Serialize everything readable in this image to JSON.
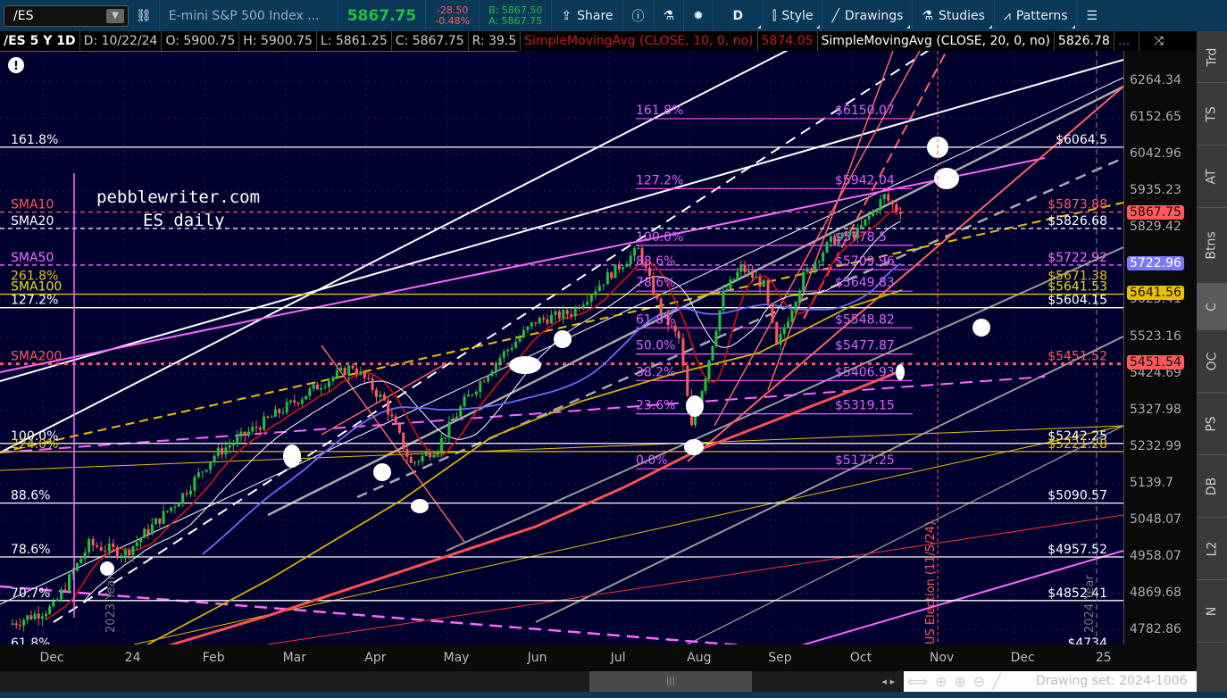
{
  "toolbar": {
    "symbol": "/ES",
    "description": "E-mini S&P 500 Index ...",
    "last": "5867.75",
    "change": "-28.50",
    "change_pct": "-0.48%",
    "bid": "B: 5867.50",
    "ask": "A: 5867.75",
    "share": "Share",
    "aggregation": "D",
    "style": "Style",
    "drawings": "Drawings",
    "studies": "Studies",
    "patterns": "Patterns",
    "colors": {
      "up": "#1ec23a",
      "down": "#ff5a5a",
      "bg": "#0b3857"
    }
  },
  "header": {
    "title": "/ES 5 Y 1D",
    "date": "D: 10/22/24",
    "open": "O: 5900.75",
    "high": "H: 5900.75",
    "low": "L: 5861.25",
    "close": "C: 5867.75",
    "range": "R: 39.5",
    "sma10_label": "SimpleMovingAvg (CLOSE, 10, 0, no)",
    "sma10_value": "5874.05",
    "sma20_label": "SimpleMovingAvg (CLOSE, 20, 0, no)",
    "sma20_value": "5826.78",
    "more": "..."
  },
  "watermark": {
    "line1": "pebblewriter.com",
    "line2": "ES daily"
  },
  "vertical_notes": {
    "election": "US Election (11/5/24)",
    "year2024": "2024 Year",
    "year2023": "2023 Year"
  },
  "price_axis": [
    "6264.34",
    "6152.65",
    "6042.96",
    "5935.23",
    "5829.42",
    "5625.41",
    "5523.16",
    "5424.69",
    "5327.98",
    "5232.99",
    "5139.7",
    "5048.07",
    "4958.07",
    "4869.68",
    "4782.86"
  ],
  "price_badges": [
    {
      "value": "5867.75",
      "color": "#ff5a5a"
    },
    {
      "value": "5722.96",
      "color": "#7a78ff"
    },
    {
      "value": "5641.56",
      "color": "#e8c000"
    },
    {
      "value": "5451.54",
      "color": "#ff5a5a"
    }
  ],
  "levels": [
    {
      "left": "161.8%",
      "right": "$6064.5",
      "price": 6064.5,
      "color": "#ffffff",
      "style": "solid"
    },
    {
      "left": "SMA10",
      "right": "$5873.88",
      "price": 5873.88,
      "color": "#ff5a5a",
      "style": "dash",
      "label_color": "#ff5a5a"
    },
    {
      "left": "SMA20",
      "right": "$5826.68",
      "price": 5826.68,
      "color": "#ffffff",
      "style": "dash"
    },
    {
      "left": "SMA50",
      "right": "$5722.92",
      "price": 5722.92,
      "color": "#ff66ff",
      "style": "dash",
      "label_color": "#ff66ff"
    },
    {
      "left": "261.8%",
      "right": "$5671.38",
      "price": 5671.38,
      "color": "#e8c000",
      "style": "none",
      "label_color": "#e8c000"
    },
    {
      "left": "SMA100",
      "right": "$5641.53",
      "price": 5641.53,
      "color": "#e8c000",
      "style": "solid",
      "label_color": "#e8e000"
    },
    {
      "left": "127.2%",
      "right": "$5604.15",
      "price": 5604.15,
      "color": "#ffffff",
      "style": "solid"
    },
    {
      "left": "SMA200",
      "right": "$5451.52",
      "price": 5451.52,
      "color": "#ff5a5a",
      "style": "dot",
      "label_color": "#ff5a5a"
    },
    {
      "left": "100.0%",
      "right": "$5242.25",
      "price": 5242.25,
      "color": "#ffffff",
      "style": "solid"
    },
    {
      "left": "224.0%",
      "right": "$5221.28",
      "price": 5221.28,
      "color": "#e8c000",
      "style": "solid",
      "label_color": "#e8c000"
    },
    {
      "left": "88.6%",
      "right": "$5090.57",
      "price": 5090.57,
      "color": "#ffffff",
      "style": "solid"
    },
    {
      "left": "78.6%",
      "right": "$4957.52",
      "price": 4957.52,
      "color": "#ffffff",
      "style": "solid"
    },
    {
      "left": "70.7%",
      "right": "$4852.41",
      "price": 4852.41,
      "color": "#ffffff",
      "style": "solid"
    },
    {
      "left": "61.8%",
      "right": "$4734",
      "price": 4734,
      "color": "#ffffff",
      "style": "none"
    }
  ],
  "fib": [
    {
      "pct": "161.8%",
      "value": "$6150.07",
      "price": 6150.07
    },
    {
      "pct": "127.2%",
      "value": "$5942.04",
      "price": 5942.04
    },
    {
      "pct": "100.0%",
      "value": "$5778.5",
      "price": 5778.5
    },
    {
      "pct": "88.6%",
      "value": "$5709.96",
      "price": 5709.96
    },
    {
      "pct": "78.6%",
      "value": "$5649.83",
      "price": 5649.83
    },
    {
      "pct": "61.8%",
      "value": "$5548.82",
      "price": 5548.82
    },
    {
      "pct": "50.0%",
      "value": "$5477.87",
      "price": 5477.87
    },
    {
      "pct": "38.2%",
      "value": "$5406.93",
      "price": 5406.93
    },
    {
      "pct": "23.6%",
      "value": "$5319.15",
      "price": 5319.15
    },
    {
      "pct": "0.0%",
      "value": "$5177.25",
      "price": 5177.25
    }
  ],
  "time_axis": [
    {
      "label": "Dec",
      "t": 0
    },
    {
      "label": "24",
      "t": 1
    },
    {
      "label": "Feb",
      "t": 2
    },
    {
      "label": "Mar",
      "t": 3
    },
    {
      "label": "Apr",
      "t": 4
    },
    {
      "label": "May",
      "t": 5
    },
    {
      "label": "Jun",
      "t": 6
    },
    {
      "label": "Jul",
      "t": 7
    },
    {
      "label": "Aug",
      "t": 8
    },
    {
      "label": "Sep",
      "t": 9
    },
    {
      "label": "Oct",
      "t": 10
    },
    {
      "label": "Nov",
      "t": 11
    },
    {
      "label": "Dec",
      "t": 12
    },
    {
      "label": "25",
      "t": 13
    }
  ],
  "chart_data": {
    "type": "candlestick",
    "scale": "log",
    "ylim": [
      4700,
      6300
    ],
    "price_path": [
      [
        -0.42,
        4795
      ],
      [
        0.13,
        4837
      ],
      [
        0.57,
        4988
      ],
      [
        1.02,
        4967
      ],
      [
        1.68,
        5099
      ],
      [
        2.12,
        5212
      ],
      [
        2.78,
        5304
      ],
      [
        3.44,
        5398
      ],
      [
        3.83,
        5446
      ],
      [
        4.22,
        5351
      ],
      [
        4.55,
        5189
      ],
      [
        4.88,
        5234
      ],
      [
        5.21,
        5351
      ],
      [
        5.65,
        5469
      ],
      [
        6.09,
        5567
      ],
      [
        6.53,
        5591
      ],
      [
        6.98,
        5691
      ],
      [
        7.36,
        5766
      ],
      [
        7.64,
        5591
      ],
      [
        7.86,
        5518
      ],
      [
        8.02,
        5281
      ],
      [
        8.19,
        5422
      ],
      [
        8.41,
        5640
      ],
      [
        8.63,
        5715
      ],
      [
        8.91,
        5666
      ],
      [
        9.07,
        5494
      ],
      [
        9.4,
        5691
      ],
      [
        9.74,
        5791
      ],
      [
        10.07,
        5816
      ],
      [
        10.4,
        5920
      ],
      [
        10.6,
        5868
      ]
    ],
    "sma100": [
      [
        1.13,
        4732
      ],
      [
        2.78,
        4901
      ],
      [
        4.44,
        5099
      ],
      [
        5.54,
        5258
      ],
      [
        6.64,
        5351
      ],
      [
        7.75,
        5422
      ],
      [
        8.85,
        5481
      ],
      [
        9.95,
        5604
      ],
      [
        10.62,
        5653
      ]
    ],
    "sma200": [
      [
        1.13,
        4722
      ],
      [
        2.78,
        4816
      ],
      [
        4.44,
        4923
      ],
      [
        6.09,
        5032
      ],
      [
        7.2,
        5132
      ],
      [
        8.08,
        5223
      ],
      [
        9.07,
        5304
      ],
      [
        10.07,
        5386
      ],
      [
        10.62,
        5434
      ]
    ]
  },
  "right_tabs": [
    "Trd",
    "TS",
    "AT",
    "Btns",
    "C",
    "OC",
    "PS",
    "DB",
    "L2",
    "N"
  ],
  "footer": {
    "drawing_set": "Drawing set: 2024-1006"
  }
}
